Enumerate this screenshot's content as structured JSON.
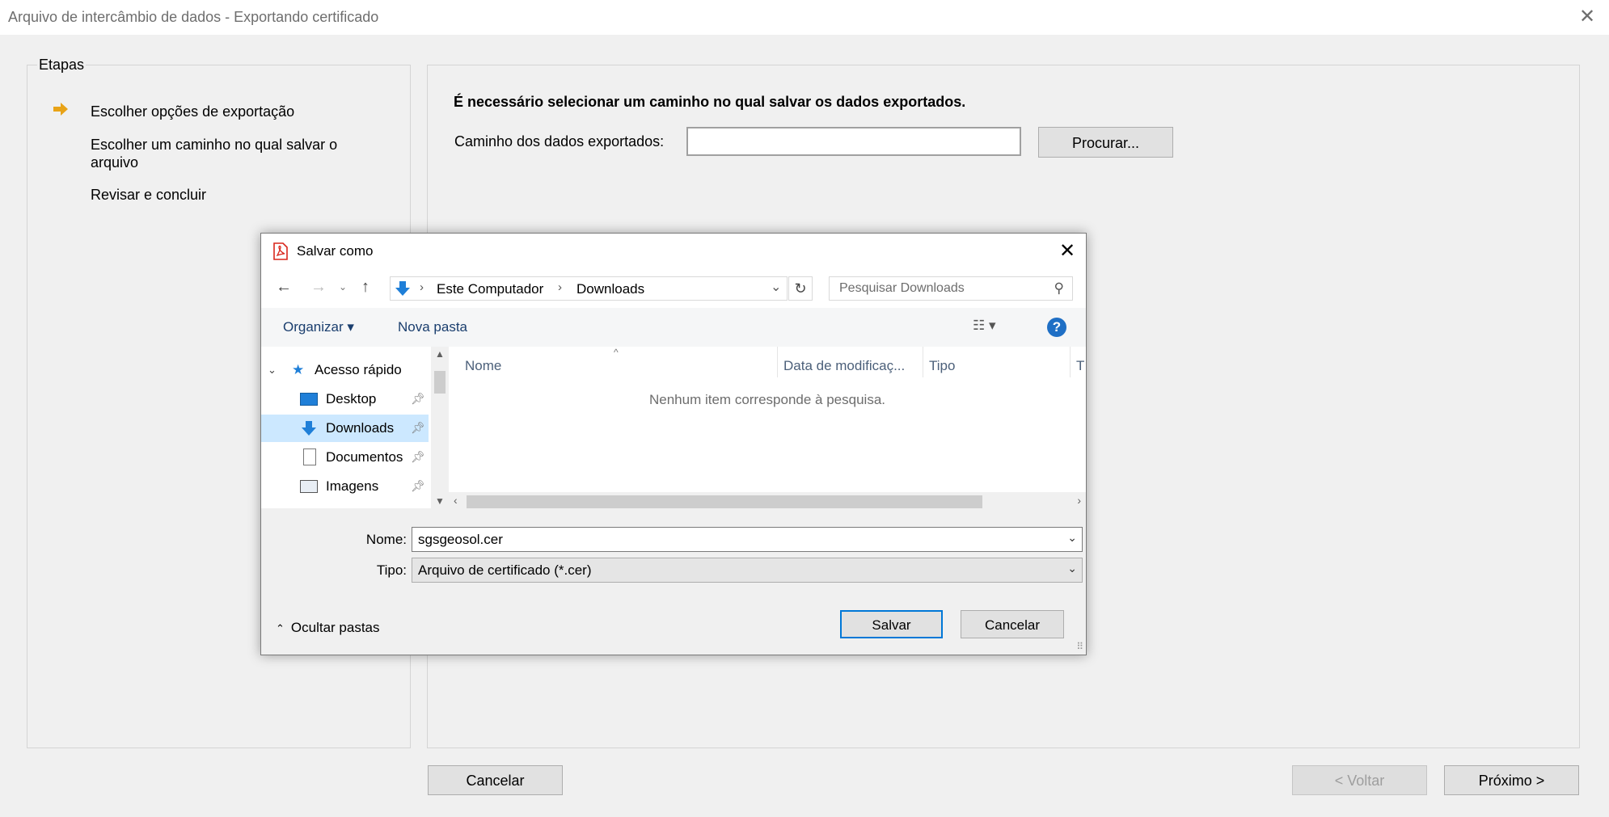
{
  "window": {
    "title": "Arquivo de intercâmbio de dados - Exportando certificado",
    "close_icon": "close-icon"
  },
  "steps": {
    "legend": "Etapas",
    "items": [
      "Escolher opções de exportação",
      "Escolher um caminho no qual salvar o arquivo",
      "Revisar e concluir"
    ],
    "current_icon": "arrow-right-icon",
    "accent": "#e8a317"
  },
  "main": {
    "heading": "É necessário selecionar um caminho no qual salvar os dados exportados.",
    "path_label": "Caminho dos dados exportados:",
    "path_value": "",
    "browse_label": "Procurar..."
  },
  "footer": {
    "cancel_label": "Cancelar",
    "back_label": "< Voltar",
    "next_label": "Próximo >"
  },
  "dialog": {
    "title": "Salvar como",
    "breadcrumb": [
      "Este Computador",
      "Downloads"
    ],
    "search_placeholder": "Pesquisar Downloads",
    "toolbar": {
      "organize_label": "Organizar",
      "new_folder_label": "Nova pasta"
    },
    "tree": {
      "quick_access": "Acesso rápido",
      "items": [
        "Desktop",
        "Downloads",
        "Documentos",
        "Imagens"
      ],
      "selected": "Downloads"
    },
    "columns": [
      "Nome",
      "Data de modificaç...",
      "Tipo",
      "T"
    ],
    "empty_message": "Nenhum item corresponde à pesquisa.",
    "filename_label": "Nome:",
    "filename_value": "sgsgeosol.cer",
    "type_label": "Tipo:",
    "type_value": "Arquivo de certificado (*.cer)",
    "hide_folders_label": "Ocultar pastas",
    "save_label": "Salvar",
    "cancel_label": "Cancelar",
    "accent": "#0078d7"
  }
}
